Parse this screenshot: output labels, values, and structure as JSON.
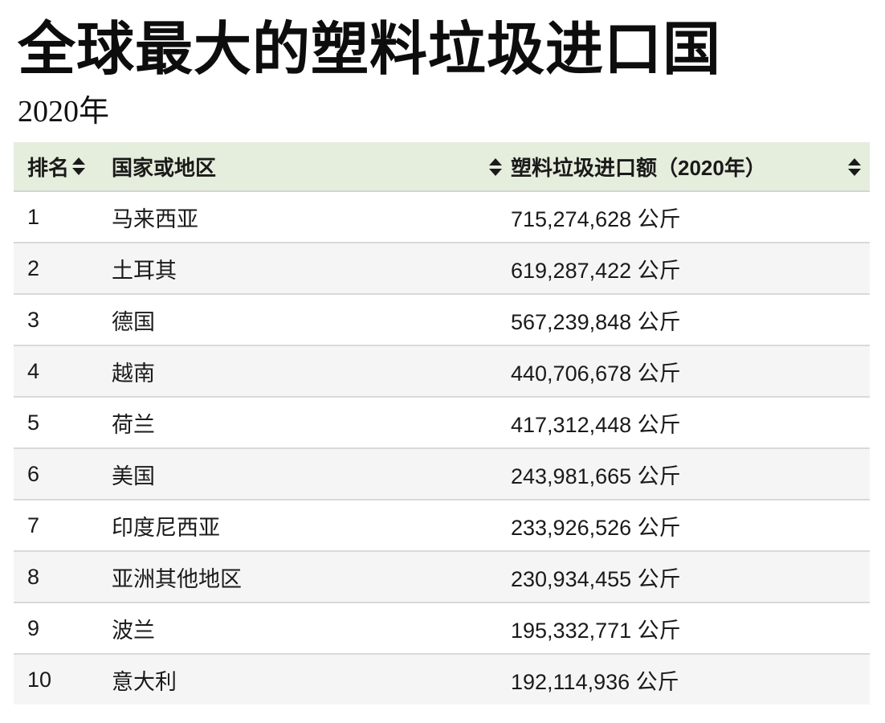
{
  "title": "全球最大的塑料垃圾进口国",
  "subtitle": "2020年",
  "table": {
    "headers": {
      "rank": "排名",
      "country": "国家或地区",
      "amount": "塑料垃圾进口额（2020年）"
    },
    "sort_icon": "sort-up-down-icon",
    "rows": [
      {
        "rank": "1",
        "country": "马来西亚",
        "amount": "715,274,628 公斤"
      },
      {
        "rank": "2",
        "country": "土耳其",
        "amount": "619,287,422 公斤"
      },
      {
        "rank": "3",
        "country": "德国",
        "amount": "567,239,848 公斤"
      },
      {
        "rank": "4",
        "country": "越南",
        "amount": "440,706,678 公斤"
      },
      {
        "rank": "5",
        "country": "荷兰",
        "amount": "417,312,448 公斤"
      },
      {
        "rank": "6",
        "country": "美国",
        "amount": "243,981,665 公斤"
      },
      {
        "rank": "7",
        "country": "印度尼西亚",
        "amount": "233,926,526 公斤"
      },
      {
        "rank": "8",
        "country": "亚洲其他地区",
        "amount": "230,934,455 公斤"
      },
      {
        "rank": "9",
        "country": "波兰",
        "amount": "195,332,771 公斤"
      },
      {
        "rank": "10",
        "country": "意大利",
        "amount": "192,114,936 公斤"
      }
    ]
  },
  "colors": {
    "header_bg": "#e5eedd",
    "row_alt_bg": "#f5f5f5",
    "divider": "#d9d9d9"
  }
}
